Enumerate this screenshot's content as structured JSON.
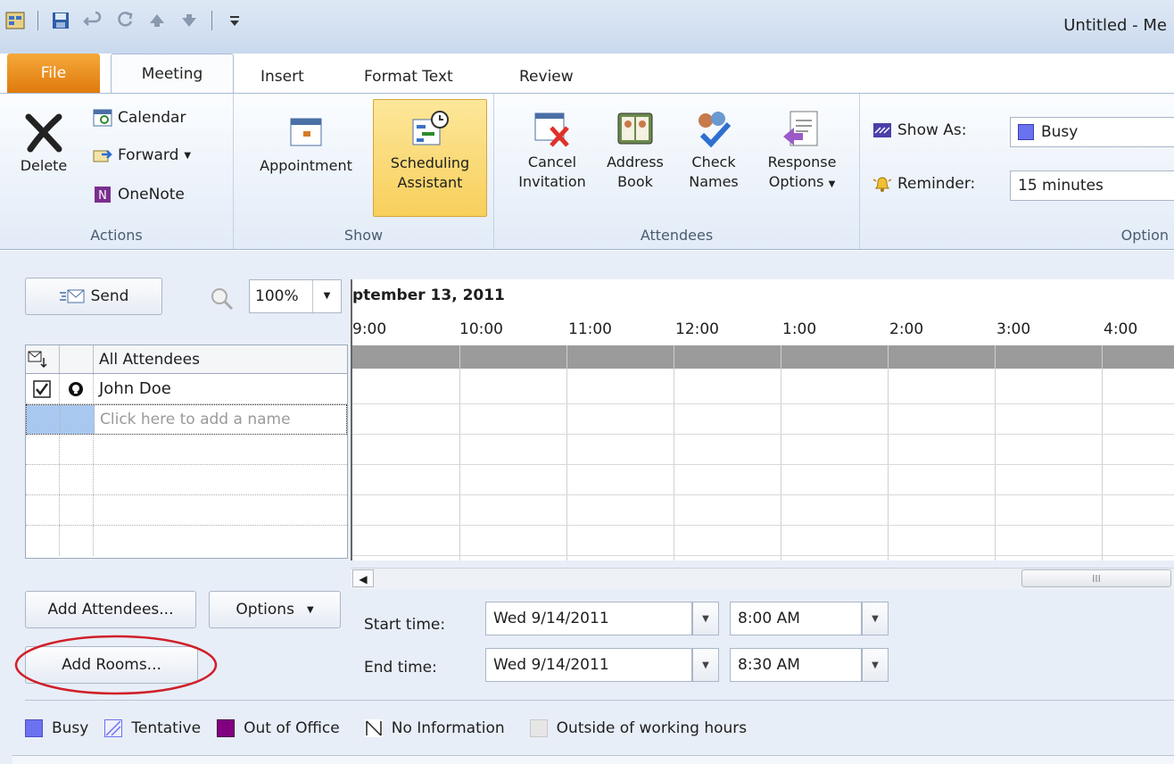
{
  "window": {
    "title": "Untitled - Me"
  },
  "tabs": [
    {
      "label": "File"
    },
    {
      "label": "Meeting"
    },
    {
      "label": "Insert"
    },
    {
      "label": "Format Text"
    },
    {
      "label": "Review"
    }
  ],
  "ribbon": {
    "actions": {
      "label": "Actions",
      "delete": "Delete",
      "calendar": "Calendar",
      "forward": "Forward",
      "onenote": "OneNote"
    },
    "show": {
      "label": "Show",
      "appointment": "Appointment",
      "scheduling_line1": "Scheduling",
      "scheduling_line2": "Assistant"
    },
    "attendees": {
      "label": "Attendees",
      "cancel_line1": "Cancel",
      "cancel_line2": "Invitation",
      "address_line1": "Address",
      "address_line2": "Book",
      "check_line1": "Check",
      "check_line2": "Names",
      "response_line1": "Response",
      "response_line2": "Options"
    },
    "options": {
      "label": "Option",
      "show_as_label": "Show As:",
      "show_as_value": "Busy",
      "reminder_label": "Reminder:",
      "reminder_value": "15 minutes"
    }
  },
  "toolbar": {
    "send": "Send",
    "zoom": "100%"
  },
  "attendees_list": {
    "header": "All Attendees",
    "rows": [
      {
        "name": "John Doe",
        "checked": true
      }
    ],
    "placeholder": "Click here to add a name"
  },
  "grid": {
    "date": "ptember 13, 2011",
    "times": [
      "9:00",
      "10:00",
      "11:00",
      "12:00",
      "1:00",
      "2:00",
      "3:00",
      "4:00"
    ]
  },
  "buttons": {
    "add_attendees": "Add Attendees...",
    "options": "Options",
    "add_rooms": "Add Rooms..."
  },
  "times": {
    "start_label": "Start time:",
    "start_date": "Wed 9/14/2011",
    "start_time": "8:00 AM",
    "end_label": "End time:",
    "end_date": "Wed 9/14/2011",
    "end_time": "8:30 AM"
  },
  "legend": [
    {
      "label": "Busy",
      "color": "#6b72f0"
    },
    {
      "label": "Tentative",
      "color": "#b8bcf5"
    },
    {
      "label": "Out of Office",
      "color": "#800080"
    },
    {
      "label": "No Information",
      "color": "#ffffff"
    },
    {
      "label": "Outside of working hours",
      "color": "#e6e6e6"
    }
  ],
  "colors": {
    "ribbon_active": "#f8cf5c",
    "highlight_ring": "#d0202a"
  }
}
